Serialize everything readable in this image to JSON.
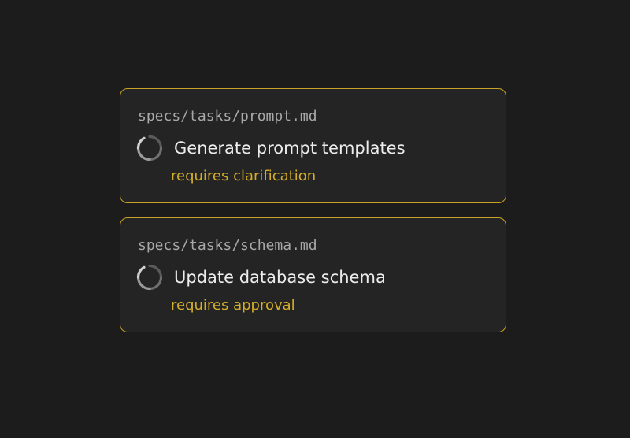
{
  "accent_color": "#c9a227",
  "status_color": "#d4ad2a",
  "background_color": "#1c1c1c",
  "tasks": [
    {
      "path": "specs/tasks/prompt.md",
      "title": "Generate prompt templates",
      "status": "requires clarification",
      "icon": "loading-spinner-icon"
    },
    {
      "path": "specs/tasks/schema.md",
      "title": "Update database schema",
      "status": "requires approval",
      "icon": "loading-spinner-icon"
    }
  ]
}
